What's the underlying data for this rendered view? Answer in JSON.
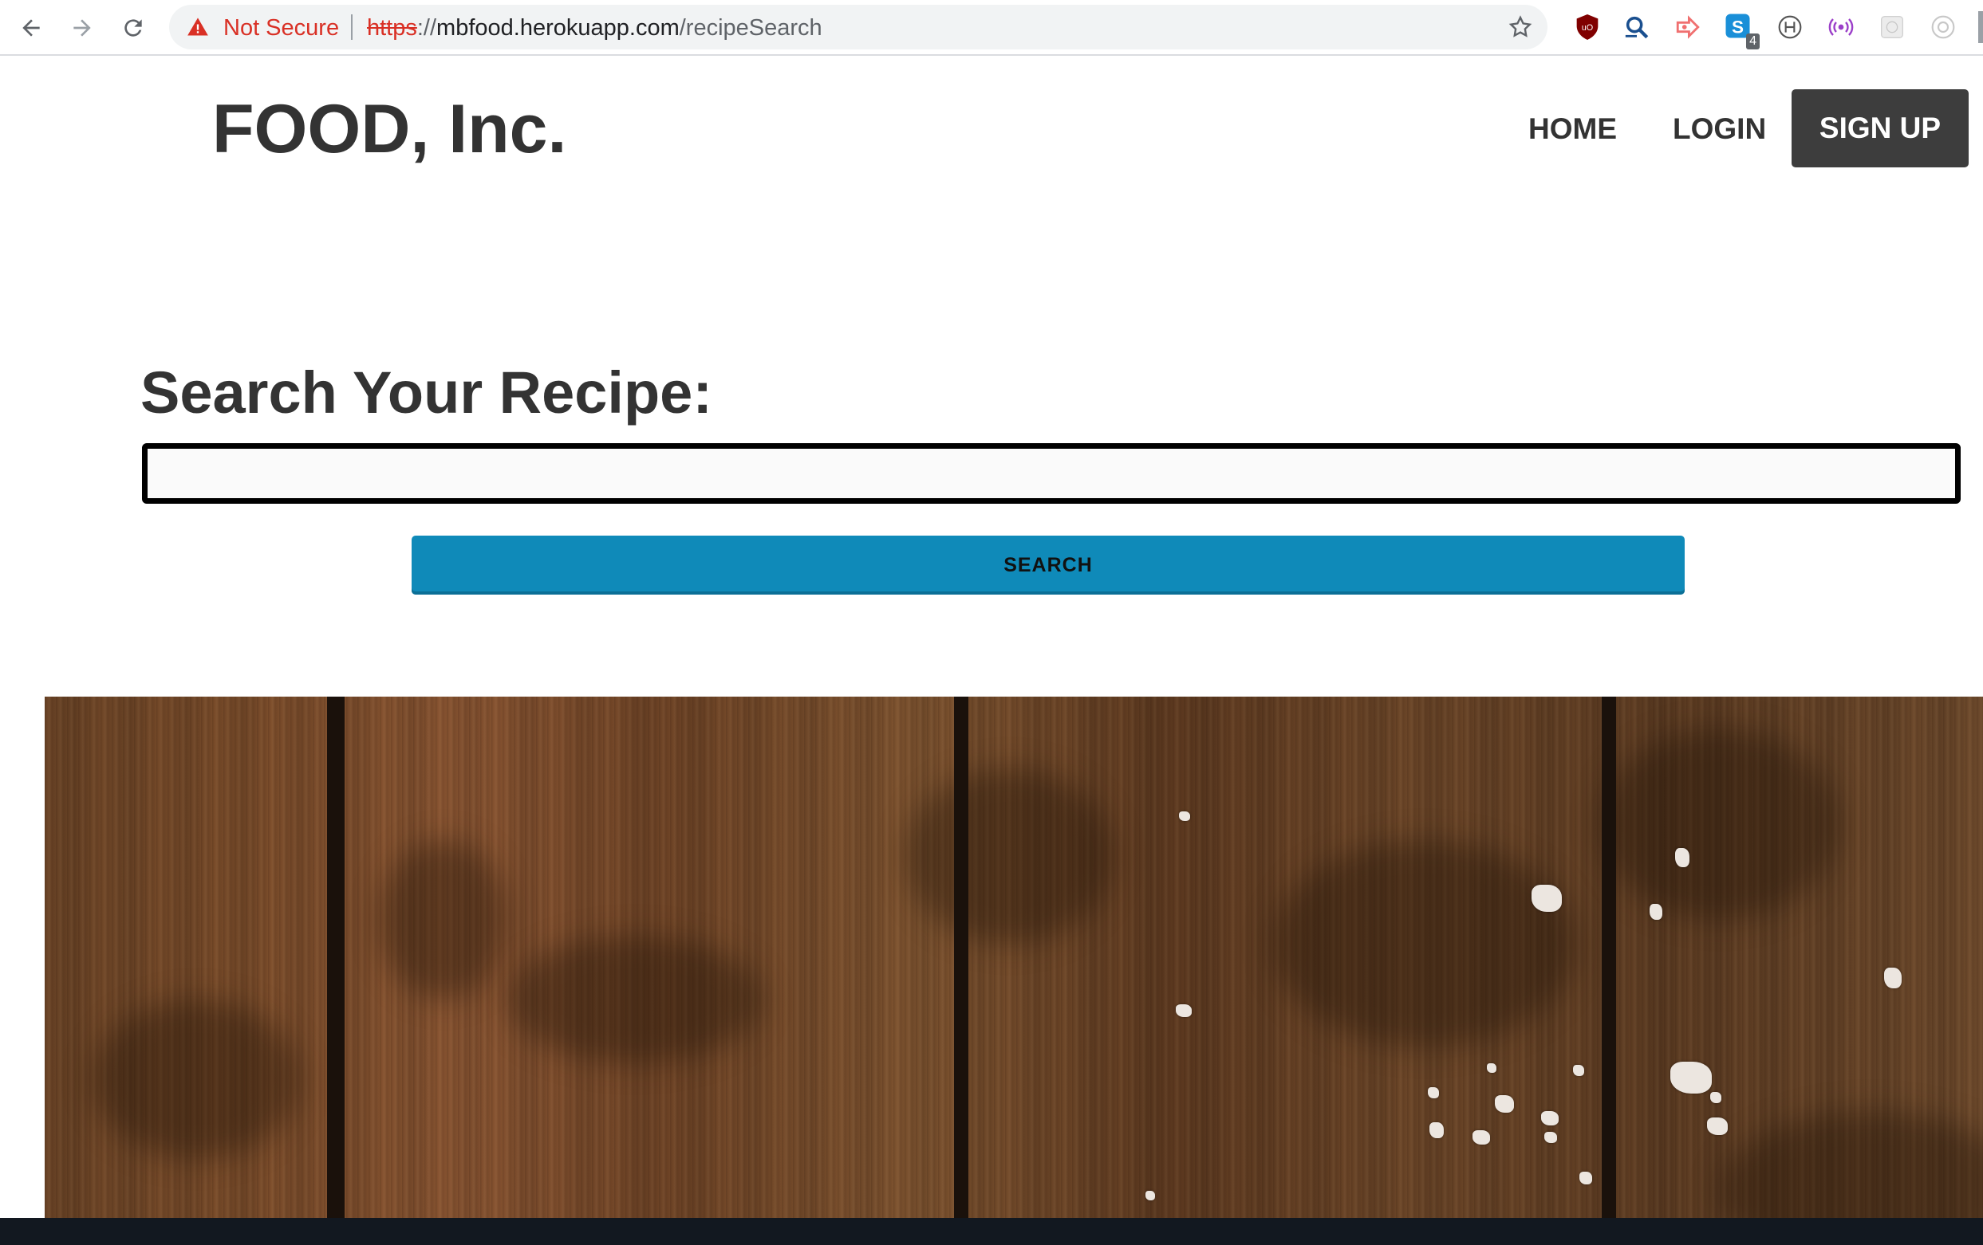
{
  "browser": {
    "security_label": "Not Secure",
    "url_scheme": "https",
    "url_separator": "://",
    "url_host": "mbfood.herokuapp.com",
    "url_path": "/recipeSearch",
    "extension_badge": "4",
    "icons": [
      "back-icon",
      "forward-icon",
      "reload-icon",
      "warning-icon",
      "star-icon",
      "ublock-icon",
      "magnifier-icon",
      "arrow-extension-icon",
      "skype-icon",
      "h-extension-icon",
      "broadcast-icon",
      "grid-extension-icon",
      "target-extension-icon"
    ],
    "colors": {
      "insecure": "#d93025",
      "omnibox_bg": "#f1f3f4"
    }
  },
  "site": {
    "logo": "FOOD, Inc.",
    "nav": {
      "home": "HOME",
      "login": "LOGIN",
      "signup": "SIGN UP"
    },
    "colors": {
      "text": "#333333",
      "signup_bg": "#3d3d3d"
    }
  },
  "search": {
    "title": "Search Your Recipe:",
    "input_value": "",
    "input_placeholder": "",
    "button_label": "SEARCH",
    "colors": {
      "button_bg": "#0f8ab9",
      "input_border": "#000000"
    }
  }
}
